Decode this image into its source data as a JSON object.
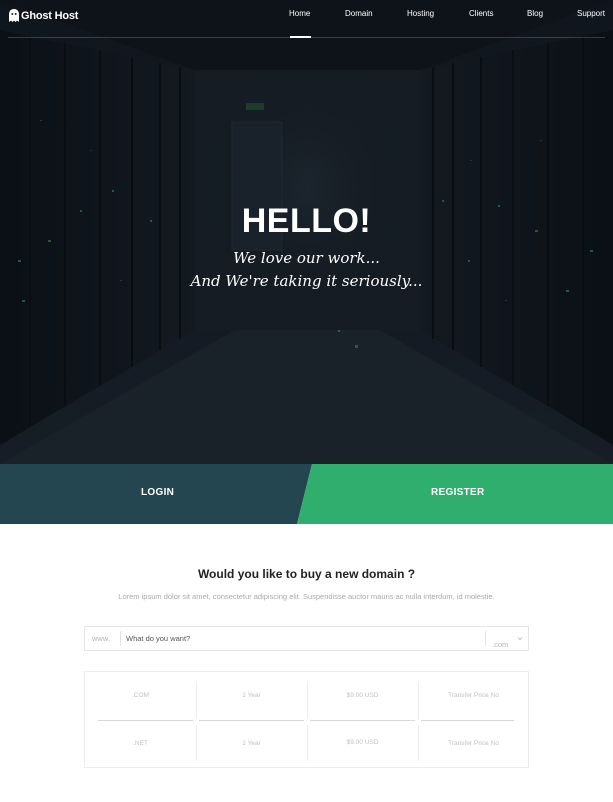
{
  "brand": {
    "name": "Ghost Host",
    "icon": "ghost-icon"
  },
  "nav": {
    "items": [
      {
        "label": "Home",
        "active": true
      },
      {
        "label": "Domain",
        "active": false
      },
      {
        "label": "Hosting",
        "active": false
      },
      {
        "label": "Clients",
        "active": false
      },
      {
        "label": "Blog",
        "active": false
      },
      {
        "label": "Support",
        "active": false
      }
    ]
  },
  "hero": {
    "title": "HELLO!",
    "subtitle_line1": "We love our work...",
    "subtitle_line2": "And We're taking it seriously..."
  },
  "auth": {
    "login_label": "LOGIN",
    "register_label": "REGISTER"
  },
  "domain": {
    "title": "Would you like to buy a new domain ?",
    "description": "Lorem ipsum dolor sit amet, consectetur adipiscing elit. Suspendisse auctor mauris ac nulla interdum, id molestie.",
    "search": {
      "prefix": "www.",
      "placeholder": "What do you want?",
      "tld_selected": ".com"
    },
    "pricing": [
      {
        "tld": ".COM",
        "period": "1 Year",
        "price": "$9.00 USD",
        "transfer": "Transfer Price No"
      },
      {
        "tld": ".NET",
        "period": "1 Year",
        "price": "$9.00 USD",
        "transfer": "Transfer Price No"
      }
    ]
  },
  "colors": {
    "login_bg": "#244650",
    "register_bg": "#2fae6e",
    "hero_bg": "#1b232d"
  }
}
